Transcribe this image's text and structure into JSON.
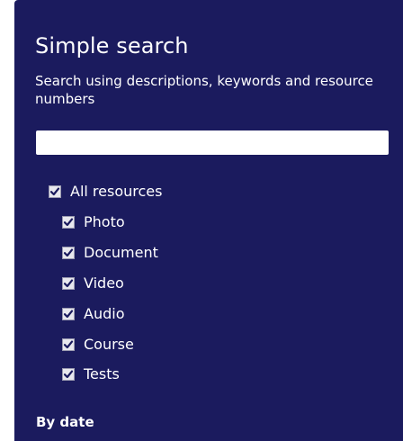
{
  "search_panel": {
    "title": "Simple search",
    "subtitle": "Search using descriptions, keywords and resource numbers",
    "search_value": "",
    "search_placeholder": ""
  },
  "filters": {
    "all": {
      "label": "All resources",
      "checked": true
    },
    "items": [
      {
        "label": "Photo",
        "checked": true
      },
      {
        "label": "Document",
        "checked": true
      },
      {
        "label": "Video",
        "checked": true
      },
      {
        "label": "Audio",
        "checked": true
      },
      {
        "label": "Course",
        "checked": true
      },
      {
        "label": "Tests",
        "checked": true
      }
    ]
  },
  "by_date": {
    "label": "By date"
  },
  "colors": {
    "panel_background": "#1b1b5e",
    "text": "#ffffff",
    "checkbox_fill": "#e8e8ee",
    "checkmark": "#1b1b5e"
  }
}
